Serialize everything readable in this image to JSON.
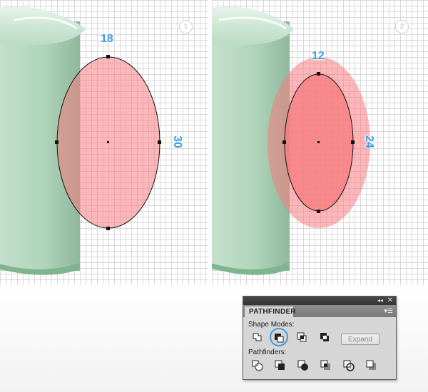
{
  "steps": [
    {
      "number": "1",
      "width_label": "18",
      "height_label": "30"
    },
    {
      "number": "2",
      "width_label": "12",
      "height_label": "24"
    }
  ],
  "pathfinder": {
    "title": "PATHFINDER",
    "shape_modes_label": "Shape Modes:",
    "pathfinders_label": "Pathfinders:",
    "expand_label": "Expand",
    "collapse_icon": "double-chevron-left-icon",
    "close_icon": "close-icon",
    "menu_icon": "panel-menu-icon"
  },
  "colors": {
    "dimension_label": "#3d9be3",
    "ellipse_fill": "#f77b80",
    "cylinder": "#b2d7bd",
    "highlight": "#3d9be3"
  }
}
